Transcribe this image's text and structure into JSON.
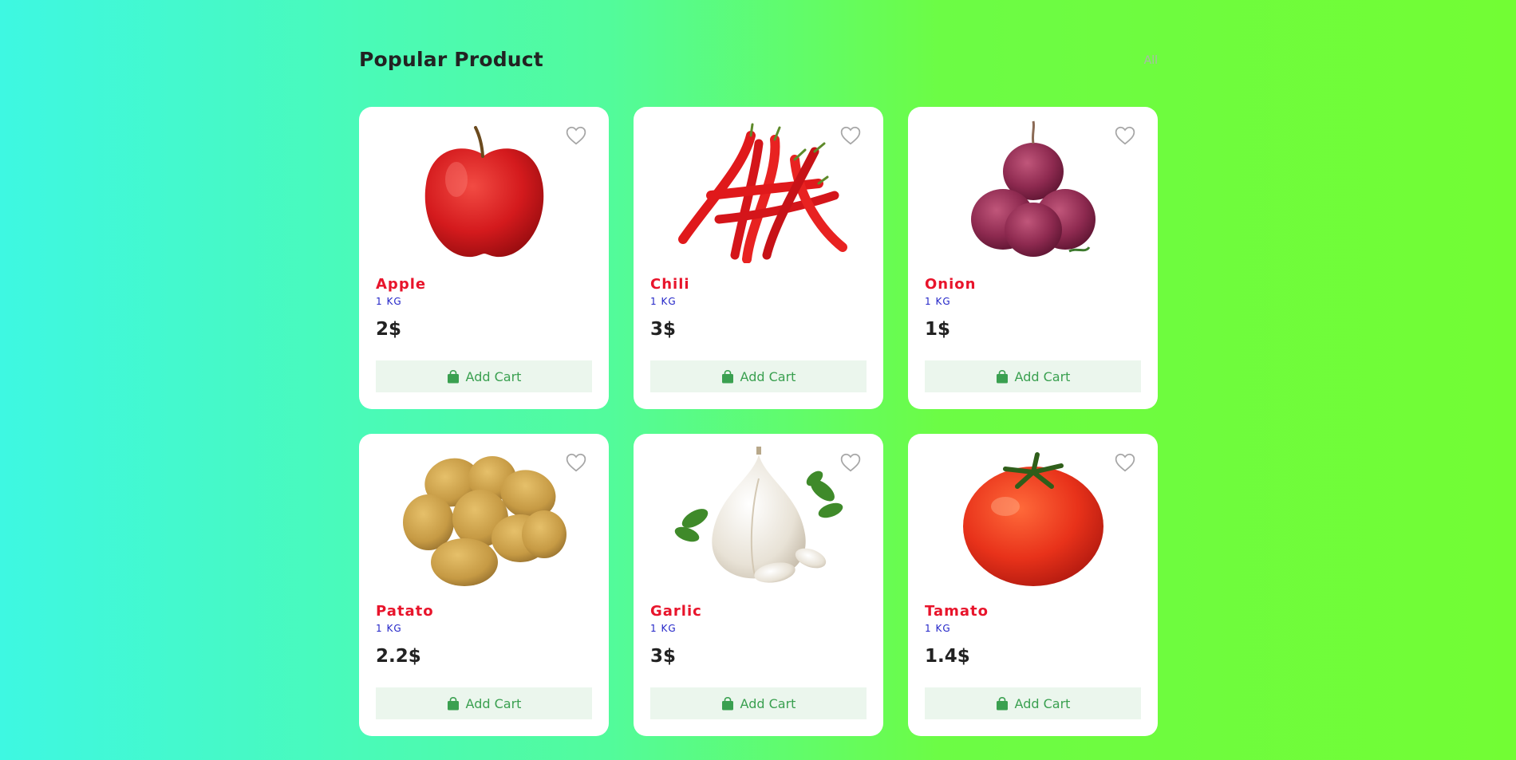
{
  "section": {
    "title": "Popular Product",
    "all_label": "All"
  },
  "products": [
    {
      "name": "Apple",
      "unit": "1 KG",
      "price": "2$",
      "cart_label": "Add Cart",
      "image": "apple"
    },
    {
      "name": "Chili",
      "unit": "1 KG",
      "price": "3$",
      "cart_label": "Add Cart",
      "image": "chili"
    },
    {
      "name": "Onion",
      "unit": "1 KG",
      "price": "1$",
      "cart_label": "Add Cart",
      "image": "onion"
    },
    {
      "name": "Patato",
      "unit": "1 KG",
      "price": "2.2$",
      "cart_label": "Add Cart",
      "image": "potato"
    },
    {
      "name": "Garlic",
      "unit": "1 KG",
      "price": "3$",
      "cart_label": "Add Cart",
      "image": "garlic"
    },
    {
      "name": "Tamato",
      "unit": "1 KG",
      "price": "1.4$",
      "cart_label": "Add Cart",
      "image": "tomato"
    }
  ],
  "icons": {
    "favorite": "heart-icon",
    "cart": "shopping-bag-icon"
  },
  "colors": {
    "product_name": "#e8142b",
    "unit": "#2325c8",
    "cart_text": "#3aa050",
    "cart_bg": "#ebf6ed"
  }
}
